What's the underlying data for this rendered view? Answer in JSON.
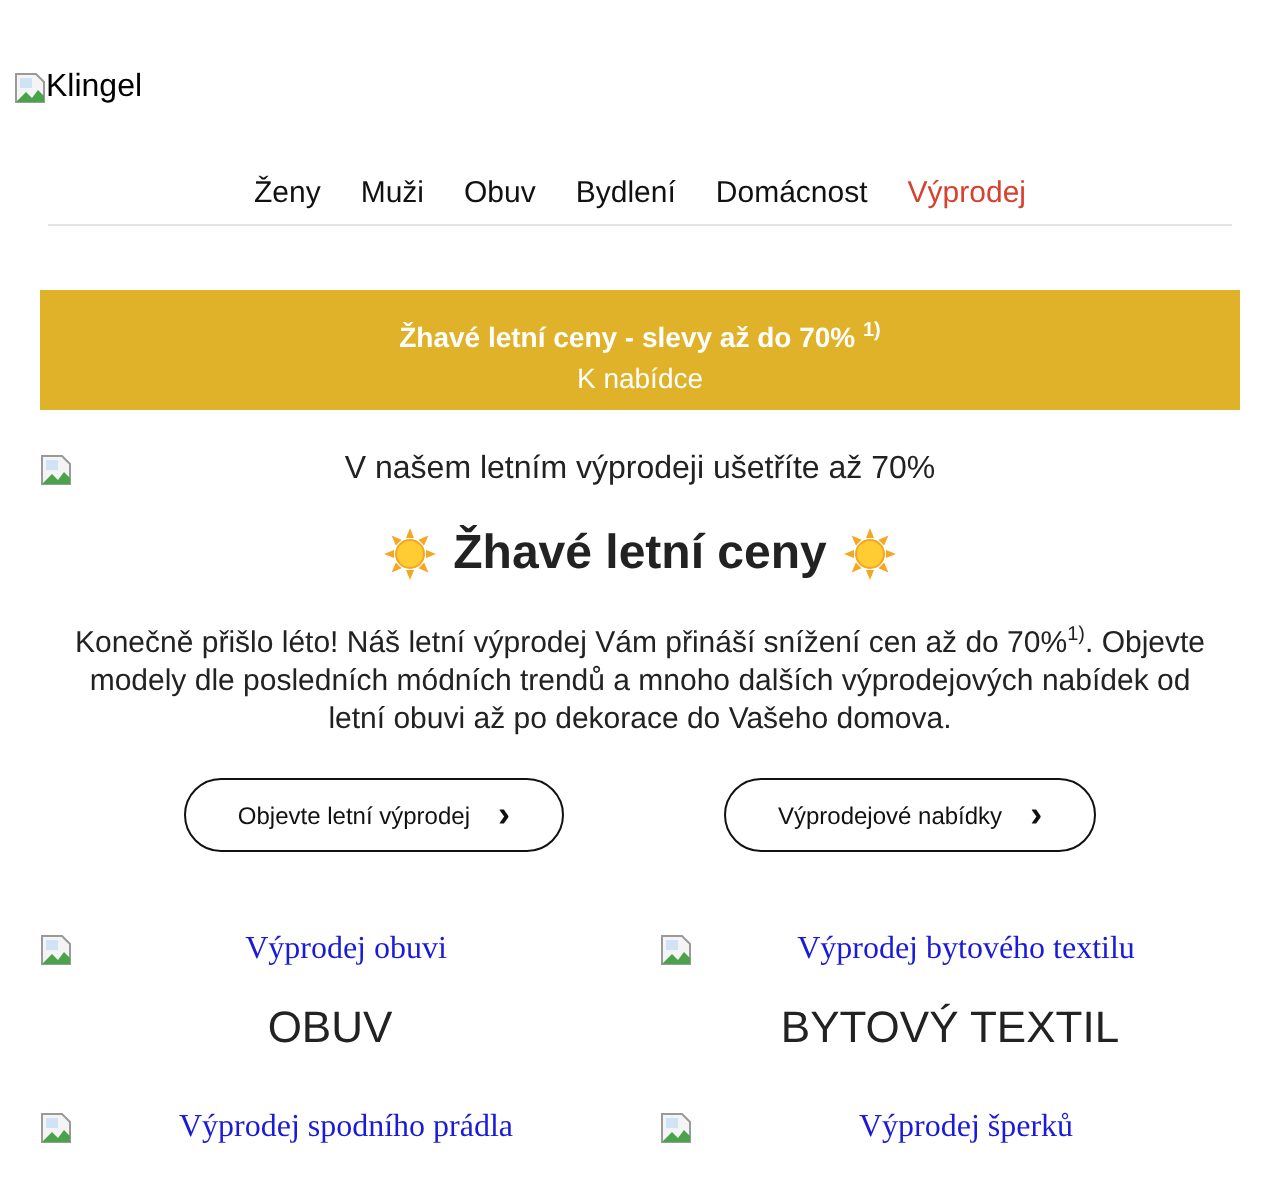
{
  "logo": {
    "alt": "Klingel"
  },
  "nav": [
    {
      "label": "Ženy",
      "kind": "normal"
    },
    {
      "label": "Muži",
      "kind": "normal"
    },
    {
      "label": "Obuv",
      "kind": "normal"
    },
    {
      "label": "Bydlení",
      "kind": "normal"
    },
    {
      "label": "Domácnost",
      "kind": "normal"
    },
    {
      "label": "Výprodej",
      "kind": "sale"
    }
  ],
  "banner": {
    "headline": "Žhavé letní ceny - slevy až do 70% $^{1)}$",
    "link": "K nabídce"
  },
  "hero_image": {
    "alt": "V našem letním výprodeji ušetříte až 70%"
  },
  "heading": "Žhavé letní ceny",
  "intro": "Konečně přišlo léto! Náš letní výprodej Vám přináší snížení cen až do 70%$^{1)}$. Objevte modely dle posledních módních trendů a mnoho dalších výprodejových nabídek od letní obuvi až po dekorace do Vašeho domova.",
  "buttons": [
    {
      "label": "Objevte letní výprodej",
      "arrow": "›"
    },
    {
      "label": "Výprodejové nabídky",
      "arrow": "›"
    }
  ],
  "categories": [
    {
      "image_alt": "Výprodej obuvi",
      "title": "OBUV"
    },
    {
      "image_alt": "Výprodej bytového textilu",
      "title": "BYTOVÝ TEXTIL"
    },
    {
      "image_alt": "Výprodej spodního prádla"
    },
    {
      "image_alt": "Výprodej šperků"
    }
  ]
}
